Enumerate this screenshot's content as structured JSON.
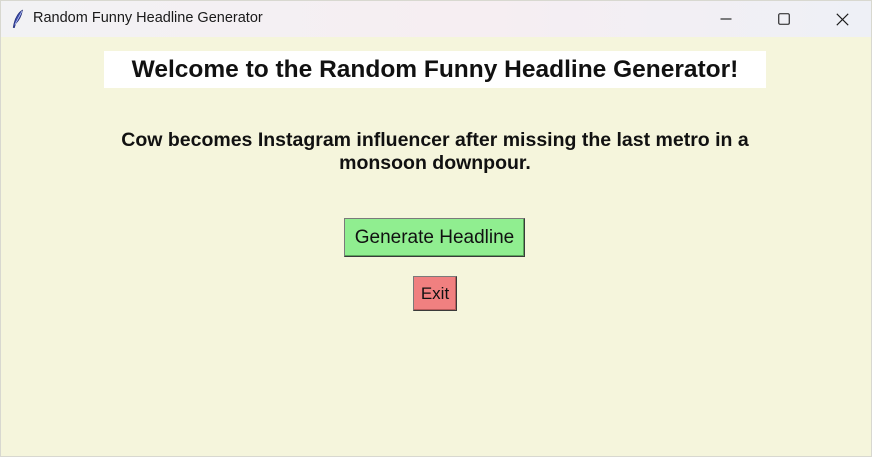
{
  "window": {
    "title": "Random Funny Headline Generator",
    "icon": "feather-icon",
    "controls": {
      "minimize_icon": "minimize-icon",
      "maximize_icon": "maximize-icon",
      "close_icon": "close-icon"
    }
  },
  "main": {
    "welcome": "Welcome to the Random Funny Headline Generator!",
    "headline_line1": "Cow becomes Instagram influencer after missing the last metro in a",
    "headline_line2": "monsoon downpour.",
    "generate_button_label": "Generate Headline",
    "exit_button_label": "Exit"
  },
  "colors": {
    "background": "#f5f5dc",
    "welcome_background": "#ffffff",
    "generate_button": "#90ee90",
    "exit_button": "#f08080"
  }
}
